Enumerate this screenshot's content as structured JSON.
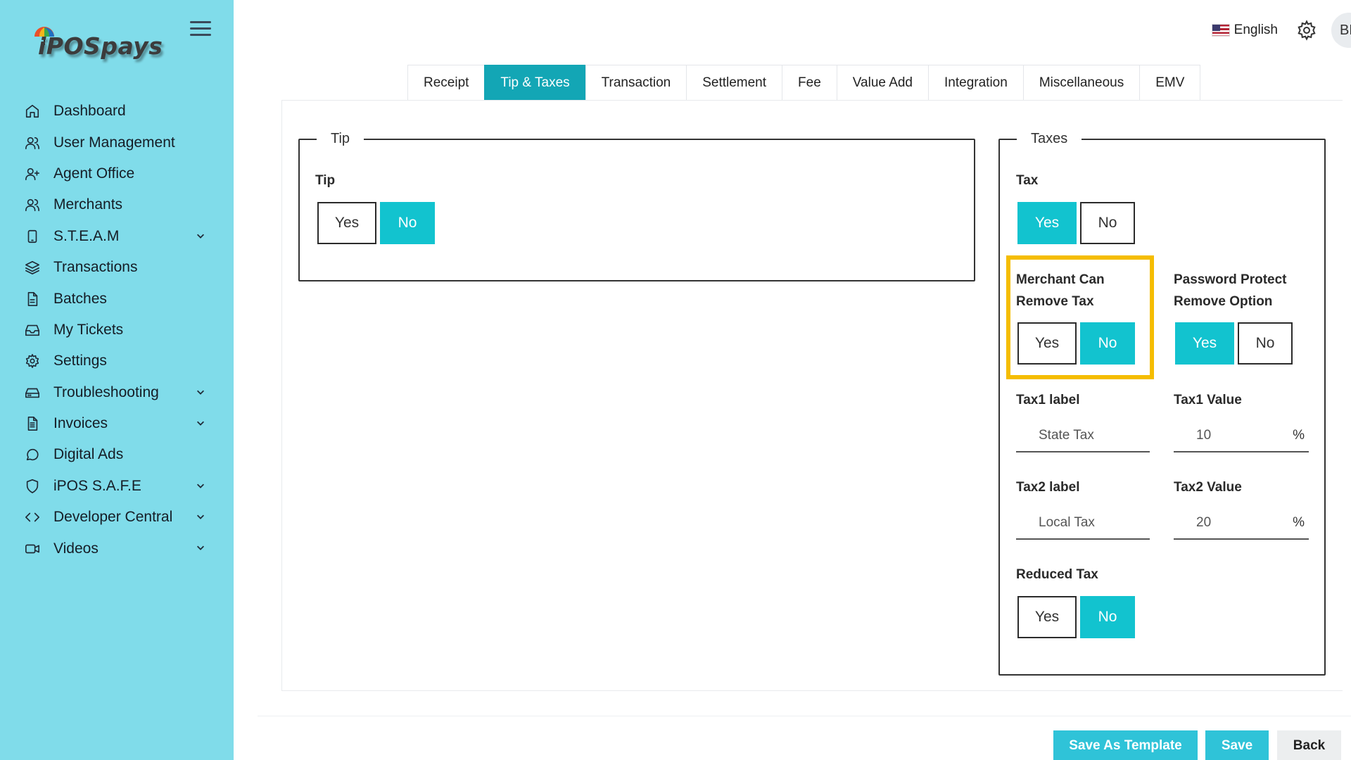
{
  "app": {
    "logo_text": "iPOSpays"
  },
  "sidebar": {
    "items": [
      {
        "label": "Dashboard",
        "icon": "home-icon"
      },
      {
        "label": "User Management",
        "icon": "users-icon"
      },
      {
        "label": "Agent Office",
        "icon": "user-plus-icon"
      },
      {
        "label": "Merchants",
        "icon": "users-icon"
      },
      {
        "label": "S.T.E.A.M",
        "icon": "tablet-icon",
        "expandable": true
      },
      {
        "label": "Transactions",
        "icon": "layers-icon"
      },
      {
        "label": "Batches",
        "icon": "file-icon"
      },
      {
        "label": "My Tickets",
        "icon": "inbox-icon"
      },
      {
        "label": "Settings",
        "icon": "gear-icon"
      },
      {
        "label": "Troubleshooting",
        "icon": "hard-drive-icon",
        "expandable": true
      },
      {
        "label": "Invoices",
        "icon": "file-text-icon",
        "expandable": true
      },
      {
        "label": "Digital Ads",
        "icon": "message-circle-icon"
      },
      {
        "label": "iPOS S.A.F.E",
        "icon": "shield-icon",
        "expandable": true
      },
      {
        "label": "Developer Central",
        "icon": "code-icon",
        "expandable": true
      },
      {
        "label": "Videos",
        "icon": "video-icon",
        "expandable": true
      }
    ]
  },
  "header": {
    "language": "English",
    "avatar_initials": "BP"
  },
  "tabs": [
    {
      "label": "Receipt",
      "active": false
    },
    {
      "label": "Tip & Taxes",
      "active": true
    },
    {
      "label": "Transaction",
      "active": false
    },
    {
      "label": "Settlement",
      "active": false
    },
    {
      "label": "Fee",
      "active": false
    },
    {
      "label": "Value Add",
      "active": false
    },
    {
      "label": "Integration",
      "active": false
    },
    {
      "label": "Miscellaneous",
      "active": false
    },
    {
      "label": "EMV",
      "active": false
    }
  ],
  "tip_section": {
    "legend": "Tip",
    "tip": {
      "label": "Tip",
      "yes": "Yes",
      "no": "No",
      "selected": "No"
    }
  },
  "taxes_section": {
    "legend": "Taxes",
    "tax": {
      "label": "Tax",
      "yes": "Yes",
      "no": "No",
      "selected": "Yes"
    },
    "merchant_can_remove_tax": {
      "label_line1": "Merchant Can",
      "label_line2": "Remove Tax",
      "yes": "Yes",
      "no": "No",
      "selected": "No"
    },
    "password_protect": {
      "label_line1": "Password Protect",
      "label_line2": "Remove Option",
      "yes": "Yes",
      "no": "No",
      "selected": "Yes"
    },
    "tax1_label": {
      "label": "Tax1 label",
      "value": "State Tax"
    },
    "tax1_value": {
      "label": "Tax1 Value",
      "value": "10",
      "unit": "%"
    },
    "tax2_label": {
      "label": "Tax2 label",
      "value": "Local Tax"
    },
    "tax2_value": {
      "label": "Tax2 Value",
      "value": "20",
      "unit": "%"
    },
    "reduced_tax": {
      "label": "Reduced Tax",
      "yes": "Yes",
      "no": "No",
      "selected": "No"
    }
  },
  "footer": {
    "save_as_template": "Save As Template",
    "save": "Save",
    "back": "Back"
  },
  "colors": {
    "sidebar_bg": "#80dcea",
    "tab_active": "#13a6b5",
    "toggle_on": "#12c3cf",
    "highlight": "#f5bd00",
    "primary_button": "#2fc3d8"
  }
}
